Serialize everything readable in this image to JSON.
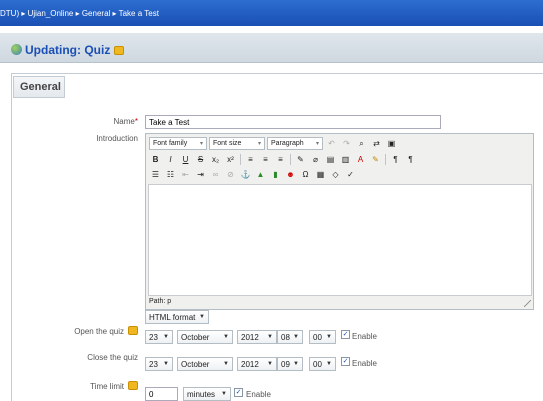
{
  "navbar": {
    "breadcrumb": "DTU) ▸ Ujian_Online ▸ General ▸ Take a Test"
  },
  "heading": {
    "title": "Updating: Quiz"
  },
  "section": {
    "legend": "General"
  },
  "name_field": {
    "label": "Name",
    "required_mark": "*",
    "value": "Take a Test"
  },
  "introduction": {
    "label": "Introduction",
    "toolbar": {
      "font_family": "Font family",
      "font_size": "Font size",
      "paragraph": "Paragraph"
    },
    "path": "Path: p"
  },
  "format_select": {
    "value": "HTML format"
  },
  "open_quiz": {
    "label": "Open the quiz",
    "day": "23",
    "month": "October",
    "year": "2012",
    "hour": "08",
    "minute": "00",
    "enable": "Enable"
  },
  "close_quiz": {
    "label": "Close the quiz",
    "day": "23",
    "month": "October",
    "year": "2012",
    "hour": "09",
    "minute": "00",
    "enable": "Enable"
  },
  "time_limit": {
    "label": "Time limit",
    "value": "0",
    "unit": "minutes",
    "enable": "Enable"
  },
  "icons": [
    "globe-icon",
    "help-icon",
    "dropdown-arrow-icon",
    "checkbox-checked-icon",
    "resize-handle-icon"
  ],
  "colors": {
    "navbar": "#1a4fb5",
    "heading": "#1a4fb5",
    "required": "#cc0000"
  }
}
